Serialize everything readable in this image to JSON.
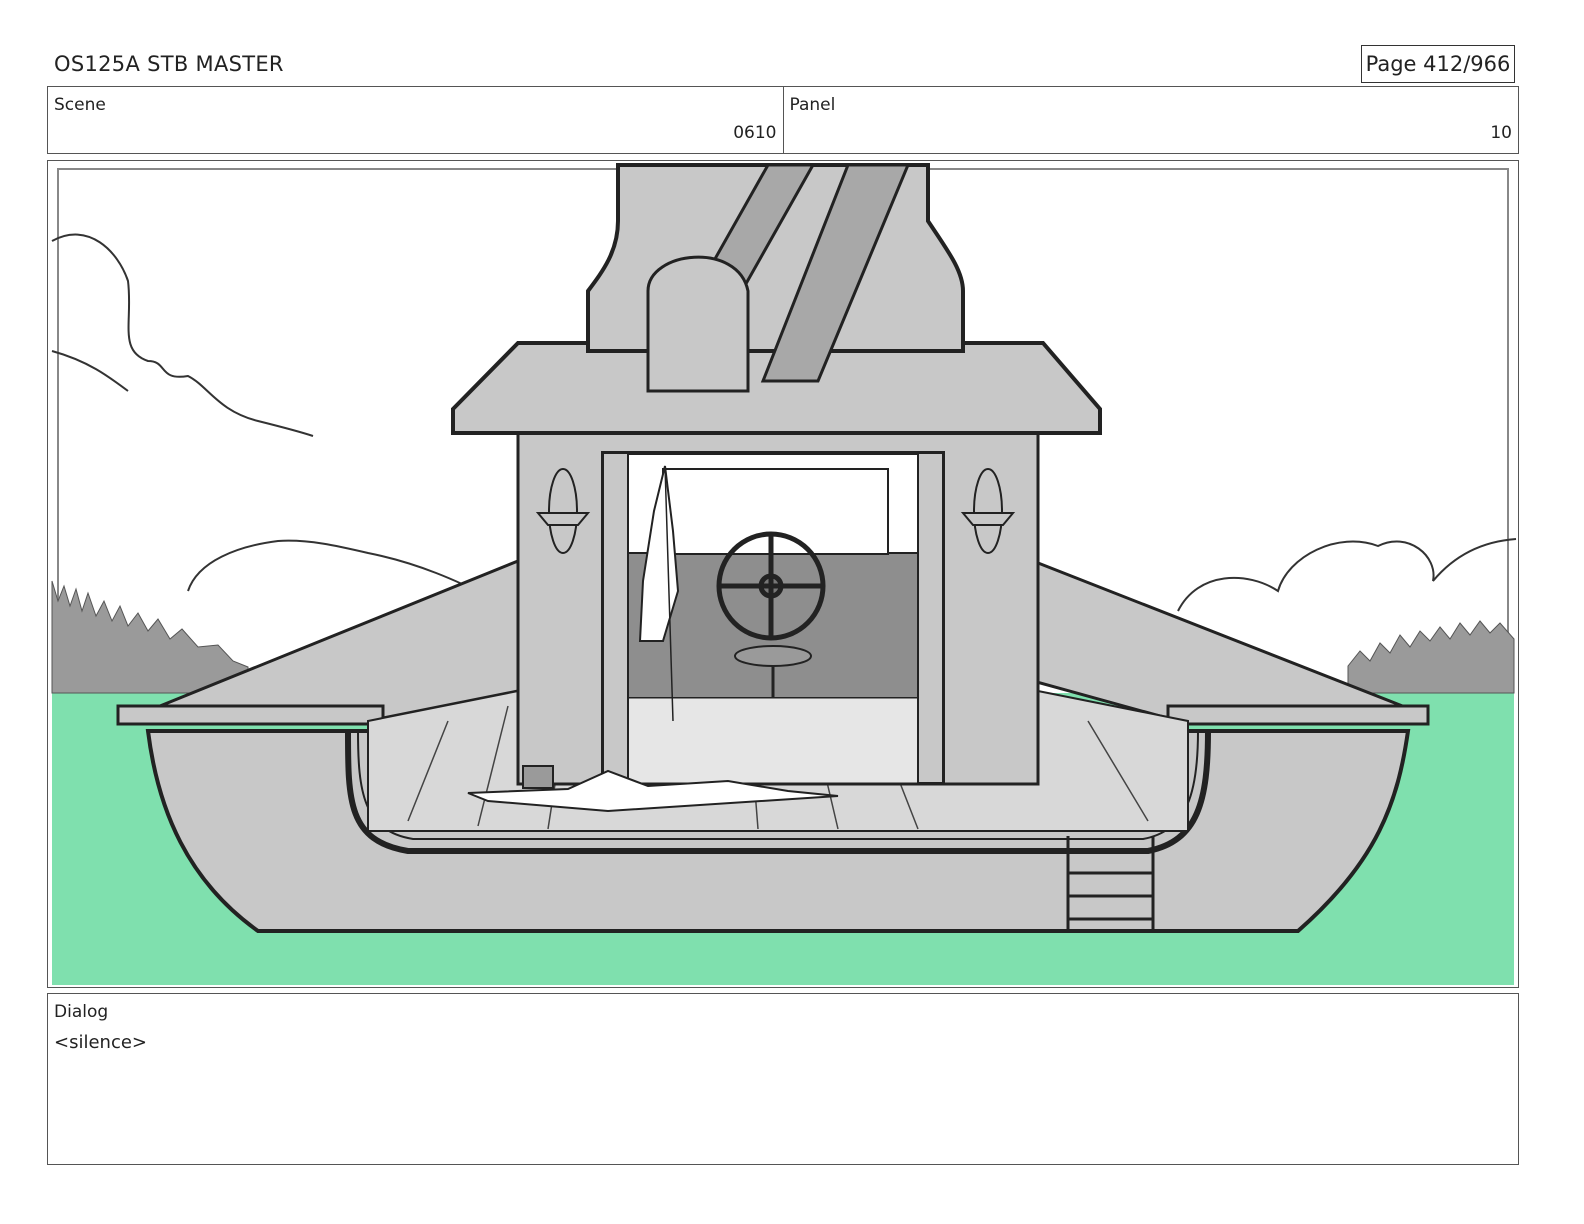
{
  "header": {
    "title": "OS125A STB MASTER",
    "page": "Page 412/966"
  },
  "info": {
    "scene_label": "Scene",
    "scene_value": "0610",
    "panel_label": "Panel",
    "panel_value": "10"
  },
  "dialog": {
    "label": "Dialog",
    "text": "<silence>"
  },
  "colors": {
    "water": "#7fe0ae",
    "boat_gray": "#c8c8c8",
    "dark_gray": "#9a9a9a",
    "line": "#222222"
  }
}
